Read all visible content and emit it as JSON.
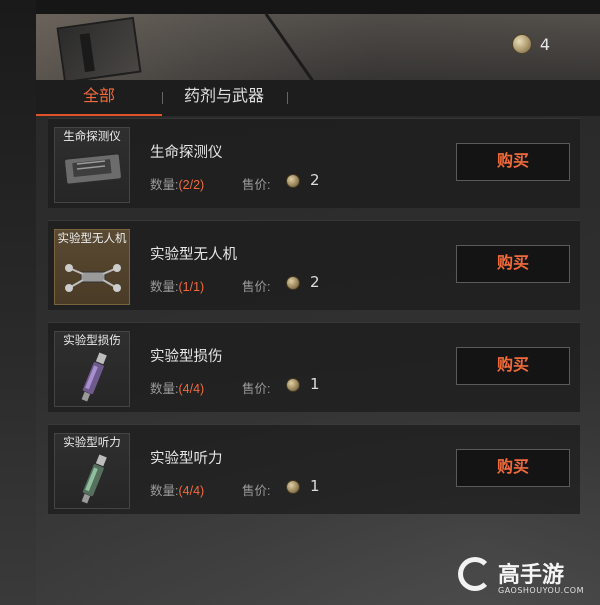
{
  "currency": {
    "icon": "coin-icon",
    "count": "4"
  },
  "tabs": [
    {
      "label": "全部",
      "active": true
    },
    {
      "label": "药剂与武器",
      "active": false
    }
  ],
  "labels": {
    "quantity": "数量:",
    "price": "售价:",
    "buy": "购买"
  },
  "items": [
    {
      "name": "生命探测仪",
      "thumb_label": "生命探测仪",
      "quantity": "(2/2)",
      "price": "2",
      "rarity": "common"
    },
    {
      "name": "实验型无人机",
      "thumb_label": "实验型无人机",
      "quantity": "(1/1)",
      "price": "2",
      "rarity": "rare"
    },
    {
      "name": "实验型损伤",
      "thumb_label": "实验型损伤",
      "quantity": "(4/4)",
      "price": "1",
      "rarity": "common"
    },
    {
      "name": "实验型听力",
      "thumb_label": "实验型听力",
      "quantity": "(4/4)",
      "price": "1",
      "rarity": "common"
    }
  ],
  "watermark": {
    "brand": "高手游",
    "url": "GAOSHOUYOU.COM"
  },
  "colors": {
    "accent": "#f06a3c",
    "rare_frame": "#5a4a33"
  }
}
